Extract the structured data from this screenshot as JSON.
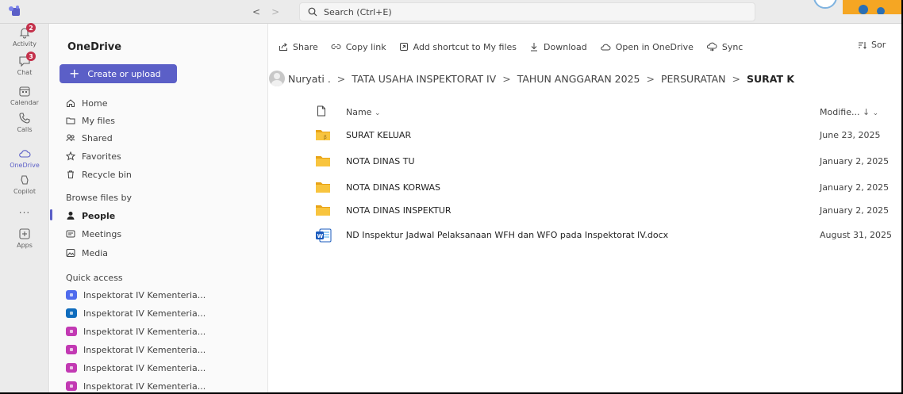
{
  "titlebar": {
    "search_placeholder": "Search (Ctrl+E)"
  },
  "rail": {
    "items": [
      {
        "label": "Activity",
        "icon": "bell-icon",
        "badge": "2"
      },
      {
        "label": "Chat",
        "icon": "chat-icon",
        "badge": "3"
      },
      {
        "label": "Calendar",
        "icon": "calendar-icon",
        "badge": ""
      },
      {
        "label": "Calls",
        "icon": "phone-icon",
        "badge": ""
      },
      {
        "label": "OneDrive",
        "icon": "cloud-icon",
        "badge": ""
      },
      {
        "label": "Copilot",
        "icon": "copilot-icon",
        "badge": ""
      },
      {
        "label": "...",
        "icon": "more-icon",
        "badge": ""
      },
      {
        "label": "Apps",
        "icon": "apps-icon",
        "badge": ""
      }
    ],
    "accent": "#5b5fc7"
  },
  "pane": {
    "title": "OneDrive",
    "create_label": "Create or upload",
    "nav": [
      {
        "label": "Home",
        "icon": "home-icon"
      },
      {
        "label": "My files",
        "icon": "folder-icon"
      },
      {
        "label": "Shared",
        "icon": "people-icon"
      },
      {
        "label": "Favorites",
        "icon": "star-icon"
      },
      {
        "label": "Recycle bin",
        "icon": "trash-icon"
      }
    ],
    "browse_label": "Browse files by",
    "browse": [
      {
        "label": "People",
        "icon": "person-icon"
      },
      {
        "label": "Meetings",
        "icon": "meetings-icon"
      },
      {
        "label": "Media",
        "icon": "image-icon"
      }
    ],
    "quick_access_label": "Quick access",
    "quick_access": [
      {
        "label": "Inspektorat IV Kementeria...",
        "color": "#4f6bed"
      },
      {
        "label": "Inspektorat IV Kementeria...",
        "color": "#0f6cbd"
      },
      {
        "label": "Inspektorat IV Kementeria...",
        "color": "#c239b3"
      },
      {
        "label": "Inspektorat IV Kementeria...",
        "color": "#c239b3"
      },
      {
        "label": "Inspektorat IV Kementeria...",
        "color": "#c239b3"
      },
      {
        "label": "Inspektorat IV Kementeria...",
        "color": "#c239b3"
      }
    ]
  },
  "toolbar": {
    "share": "Share",
    "copy_link": "Copy link",
    "add_shortcut": "Add shortcut to My files",
    "download": "Download",
    "open_in_onedrive": "Open in OneDrive",
    "sync": "Sync",
    "sort": "Sor"
  },
  "breadcrumb": {
    "items": [
      "Nuryati .",
      "TATA USAHA INSPEKTORAT IV",
      "TAHUN ANGGARAN 2025",
      "PERSURATAN"
    ],
    "current": "SURAT K",
    "separator": ">"
  },
  "list": {
    "name_header": "Name",
    "modified_header": "Modifie...",
    "rows": [
      {
        "name": "SURAT KELUAR",
        "modified": "June 23, 2025",
        "type": "folder"
      },
      {
        "name": "NOTA DINAS TU",
        "modified": "January 2, 2025",
        "type": "folder"
      },
      {
        "name": "NOTA DINAS KORWAS",
        "modified": "January 2, 2025",
        "type": "folder"
      },
      {
        "name": "NOTA DINAS INSPEKTUR",
        "modified": "January 2, 2025",
        "type": "folder"
      },
      {
        "name": "ND Inspektur Jadwal Pelaksanaan WFH dan WFO pada Inspektorat IV.docx",
        "modified": "August 31, 2025",
        "type": "word"
      }
    ]
  }
}
